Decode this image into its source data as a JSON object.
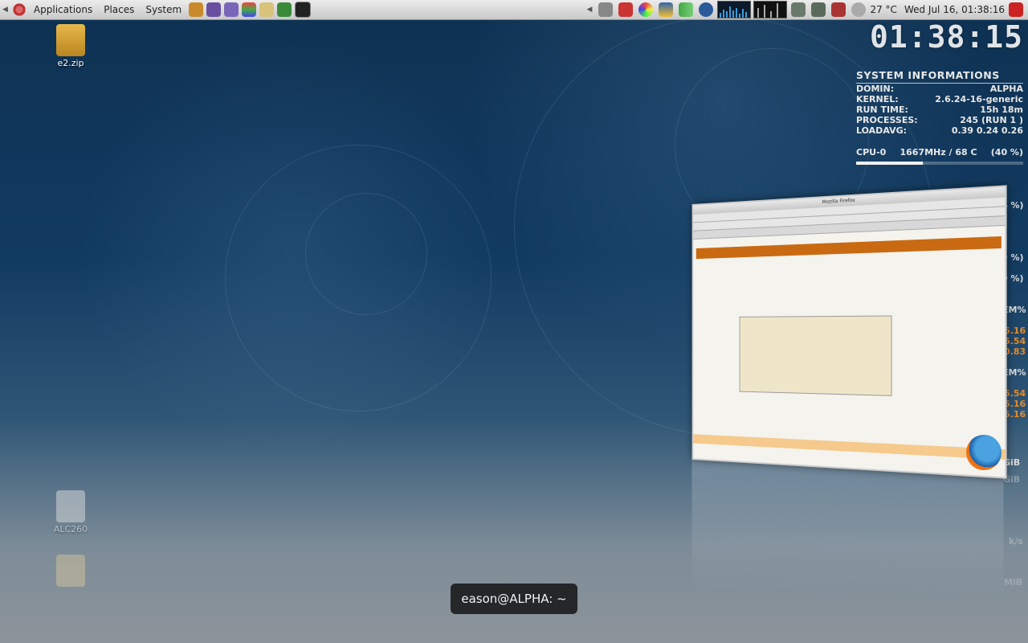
{
  "panel": {
    "menus": {
      "applications": "Applications",
      "places": "Places",
      "system": "System"
    },
    "temperature": "27 °C",
    "datetime": "Wed Jul 16, 01:38:16"
  },
  "desktop_icons": {
    "e2zip": "e2.zip",
    "alc260": "ALC260"
  },
  "conky": {
    "time": "01:38:15",
    "header": "SYSTEM INFORMATIONS",
    "rows": [
      {
        "label": "DOMIN:",
        "value": "ALPHA"
      },
      {
        "label": "KERNEL:",
        "value": "2.6.24-16-generic"
      },
      {
        "label": "RUN TIME:",
        "value": "15h 18m"
      },
      {
        "label": "PROCESSES:",
        "value": "245  (RUN 1 )"
      },
      {
        "label": "LOADAVG:",
        "value": "0.39 0.24 0.26"
      }
    ],
    "cpu0": {
      "label": "CPU-0",
      "freq": "1667MHz / 68  C",
      "pct": "(40 %)",
      "level": 0.4
    },
    "fragments": [
      "4 %)",
      "9 %)",
      "0 %)",
      "EM%",
      "6.16",
      "6.54",
      "0.83",
      "EM%",
      "6.54",
      "6.16",
      "6.16",
      "GiB",
      "GiB",
      "k/s",
      "MiB"
    ]
  },
  "firefox_title": "Mozilla Firefox",
  "terminal_tooltip": "eason@ALPHA: ~"
}
